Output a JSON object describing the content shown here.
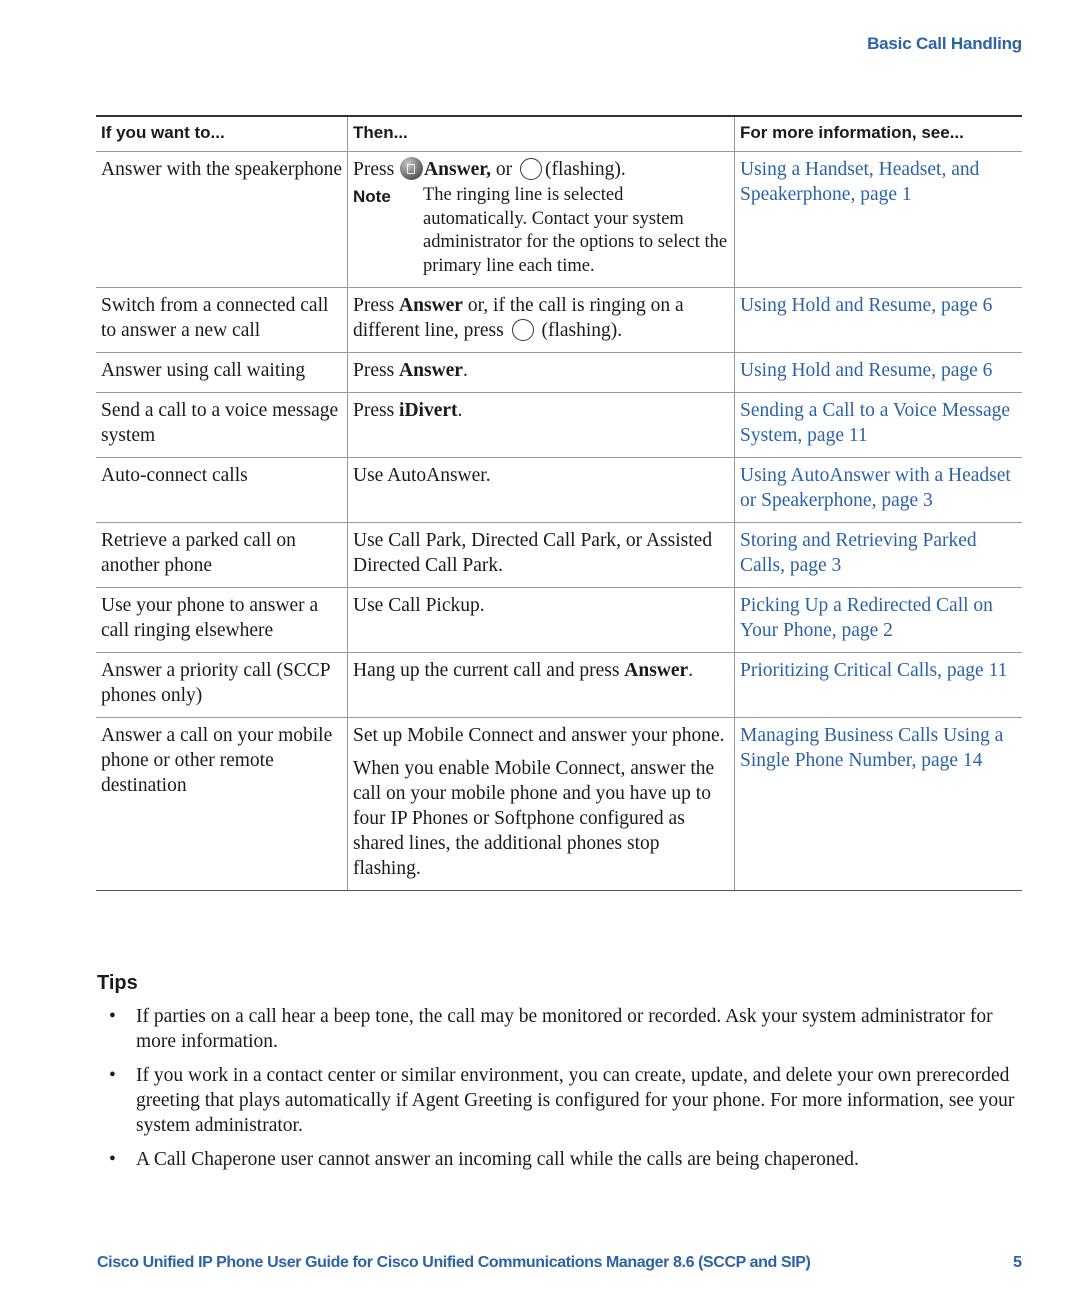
{
  "header": {
    "section_title": "Basic Call Handling"
  },
  "table": {
    "headers": [
      "If you want to...",
      "Then...",
      "For more information, see..."
    ],
    "rows": [
      {
        "want": "Answer with the speakerphone",
        "then_pre": "Press",
        "then_bold": "Answer,",
        "then_mid": "or",
        "then_post": "(flashing).",
        "note_label": "Note",
        "note_text": "The ringing line is selected automatically. Contact your system administrator for the options to select the primary line each time.",
        "link": "Using a Handset, Headset, and Speakerphone, page 1"
      },
      {
        "want": "Switch from a connected call to answer a new call",
        "then_pre": "Press",
        "then_bold": "Answer",
        "then_mid": "or, if the call is ringing on a different line, press",
        "then_post": "(flashing).",
        "link": "Using Hold and Resume, page 6"
      },
      {
        "want": "Answer using call waiting",
        "then_pre": "Press",
        "then_bold": "Answer",
        "then_post": ".",
        "link": "Using Hold and Resume, page 6"
      },
      {
        "want": "Send a call to a voice message system",
        "then_pre": "Press",
        "then_bold": "iDivert",
        "then_post": ".",
        "link": "Sending a Call to a Voice Message System, page 11"
      },
      {
        "want": "Auto-connect calls",
        "then": "Use AutoAnswer.",
        "link": "Using AutoAnswer with a Headset or Speakerphone, page 3"
      },
      {
        "want": "Retrieve a parked call on another phone",
        "then": "Use Call Park, Directed Call Park, or Assisted Directed Call Park.",
        "link": "Storing and Retrieving Parked Calls, page 3"
      },
      {
        "want": "Use your phone to answer a call ringing elsewhere",
        "then": "Use Call Pickup.",
        "link": "Picking Up a Redirected Call on Your Phone, page 2"
      },
      {
        "want": "Answer a priority call (SCCP phones only)",
        "then_pre": "Hang up the current call and press",
        "then_bold": "Answer",
        "then_post": ".",
        "link": "Prioritizing Critical Calls, page 11"
      },
      {
        "want": "Answer a call on your mobile phone or other remote destination",
        "then": "Set up Mobile Connect and answer your phone.",
        "then_para2": "When you enable Mobile Connect, answer the call on your mobile phone and you have up to four IP Phones or Softphone configured as shared lines, the additional phones stop flashing.",
        "link": "Managing Business Calls Using a Single Phone Number, page 14"
      }
    ]
  },
  "tips": {
    "title": "Tips",
    "bullet": "•",
    "items": [
      "If parties on a call hear a beep tone, the call may be monitored or recorded. Ask your system administrator for more information.",
      "If you work in a contact center or similar environment, you can create, update, and delete your own prerecorded greeting that plays automatically if Agent Greeting is configured for your phone. For more information, see your system administrator.",
      "A Call Chaperone user cannot answer an incoming call while the calls are being chaperoned."
    ]
  },
  "footer": {
    "title": "Cisco Unified IP Phone User Guide for Cisco Unified Communications Manager 8.6 (SCCP and SIP)",
    "page_number": "5"
  },
  "colors": {
    "link": "#2b63a6",
    "heading_blue": "#2b63a6"
  }
}
